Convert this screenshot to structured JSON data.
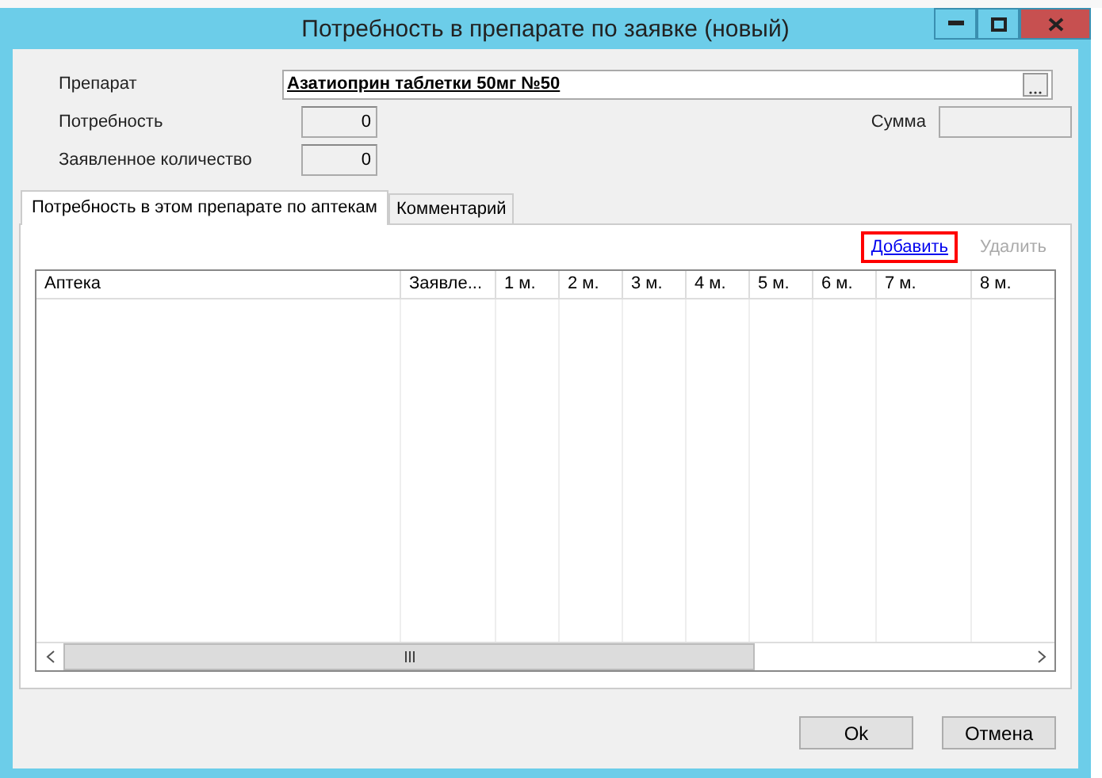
{
  "window": {
    "title": "Потребность в препарате по заявке (новый)"
  },
  "form": {
    "drug": {
      "label": "Препарат",
      "value": "Азатиоприн таблетки  50мг №50"
    },
    "need": {
      "label": "Потребность",
      "value": "0"
    },
    "sum": {
      "label": "Сумма"
    },
    "declared": {
      "label": "Заявленное количество",
      "value": "0"
    }
  },
  "tabs": [
    {
      "label": "Потребность в этом препарате по аптекам",
      "selected": true
    },
    {
      "label": "Комментарий",
      "selected": false
    }
  ],
  "actions": [
    {
      "label": "Добавить",
      "disabled": false,
      "highlighted": true
    },
    {
      "label": "Удалить",
      "disabled": true,
      "highlighted": false
    }
  ],
  "table": {
    "columns": [
      {
        "label": "Аптека"
      },
      {
        "label": "Заявле..."
      },
      {
        "label": "1 м."
      },
      {
        "label": "2 м."
      },
      {
        "label": "3 м."
      },
      {
        "label": "4 м."
      },
      {
        "label": "5 м."
      },
      {
        "label": "6 м."
      },
      {
        "label": "7 м."
      },
      {
        "label": "8 м."
      }
    ]
  },
  "buttons": [
    "Ok",
    "Отмена"
  ]
}
